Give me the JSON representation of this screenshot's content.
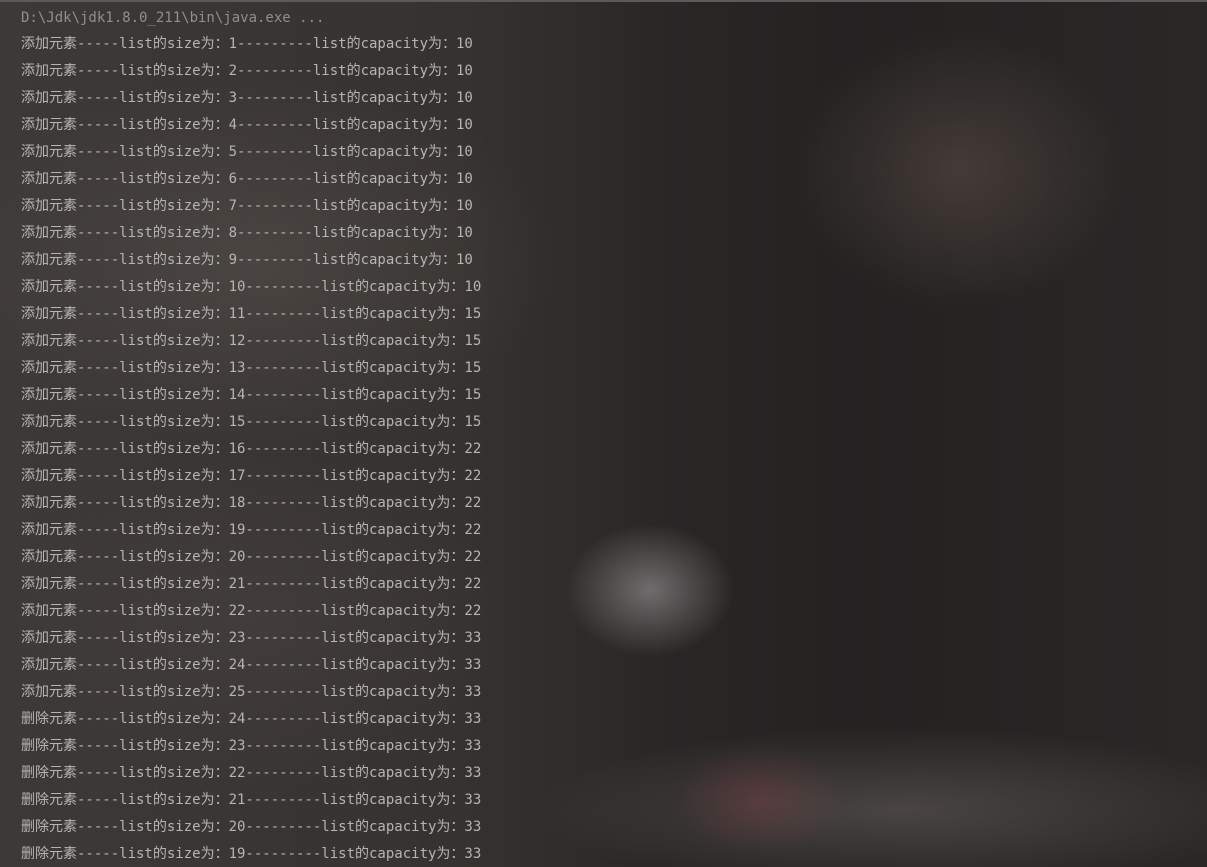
{
  "console": {
    "command": "D:\\Jdk\\jdk1.8.0_211\\bin\\java.exe ...",
    "lines": [
      "添加元素-----list的size为：1---------list的capacity为：10",
      "添加元素-----list的size为：2---------list的capacity为：10",
      "添加元素-----list的size为：3---------list的capacity为：10",
      "添加元素-----list的size为：4---------list的capacity为：10",
      "添加元素-----list的size为：5---------list的capacity为：10",
      "添加元素-----list的size为：6---------list的capacity为：10",
      "添加元素-----list的size为：7---------list的capacity为：10",
      "添加元素-----list的size为：8---------list的capacity为：10",
      "添加元素-----list的size为：9---------list的capacity为：10",
      "添加元素-----list的size为：10---------list的capacity为：10",
      "添加元素-----list的size为：11---------list的capacity为：15",
      "添加元素-----list的size为：12---------list的capacity为：15",
      "添加元素-----list的size为：13---------list的capacity为：15",
      "添加元素-----list的size为：14---------list的capacity为：15",
      "添加元素-----list的size为：15---------list的capacity为：15",
      "添加元素-----list的size为：16---------list的capacity为：22",
      "添加元素-----list的size为：17---------list的capacity为：22",
      "添加元素-----list的size为：18---------list的capacity为：22",
      "添加元素-----list的size为：19---------list的capacity为：22",
      "添加元素-----list的size为：20---------list的capacity为：22",
      "添加元素-----list的size为：21---------list的capacity为：22",
      "添加元素-----list的size为：22---------list的capacity为：22",
      "添加元素-----list的size为：23---------list的capacity为：33",
      "添加元素-----list的size为：24---------list的capacity为：33",
      "添加元素-----list的size为：25---------list的capacity为：33",
      "删除元素-----list的size为：24---------list的capacity为：33",
      "删除元素-----list的size为：23---------list的capacity为：33",
      "删除元素-----list的size为：22---------list的capacity为：33",
      "删除元素-----list的size为：21---------list的capacity为：33",
      "删除元素-----list的size为：20---------list的capacity为：33",
      "删除元素-----list的size为：19---------list的capacity为：33"
    ]
  },
  "colors": {
    "command_text": "#8f8f8f",
    "output_text": "#b5b5b5",
    "background": "#2b2b2b"
  }
}
